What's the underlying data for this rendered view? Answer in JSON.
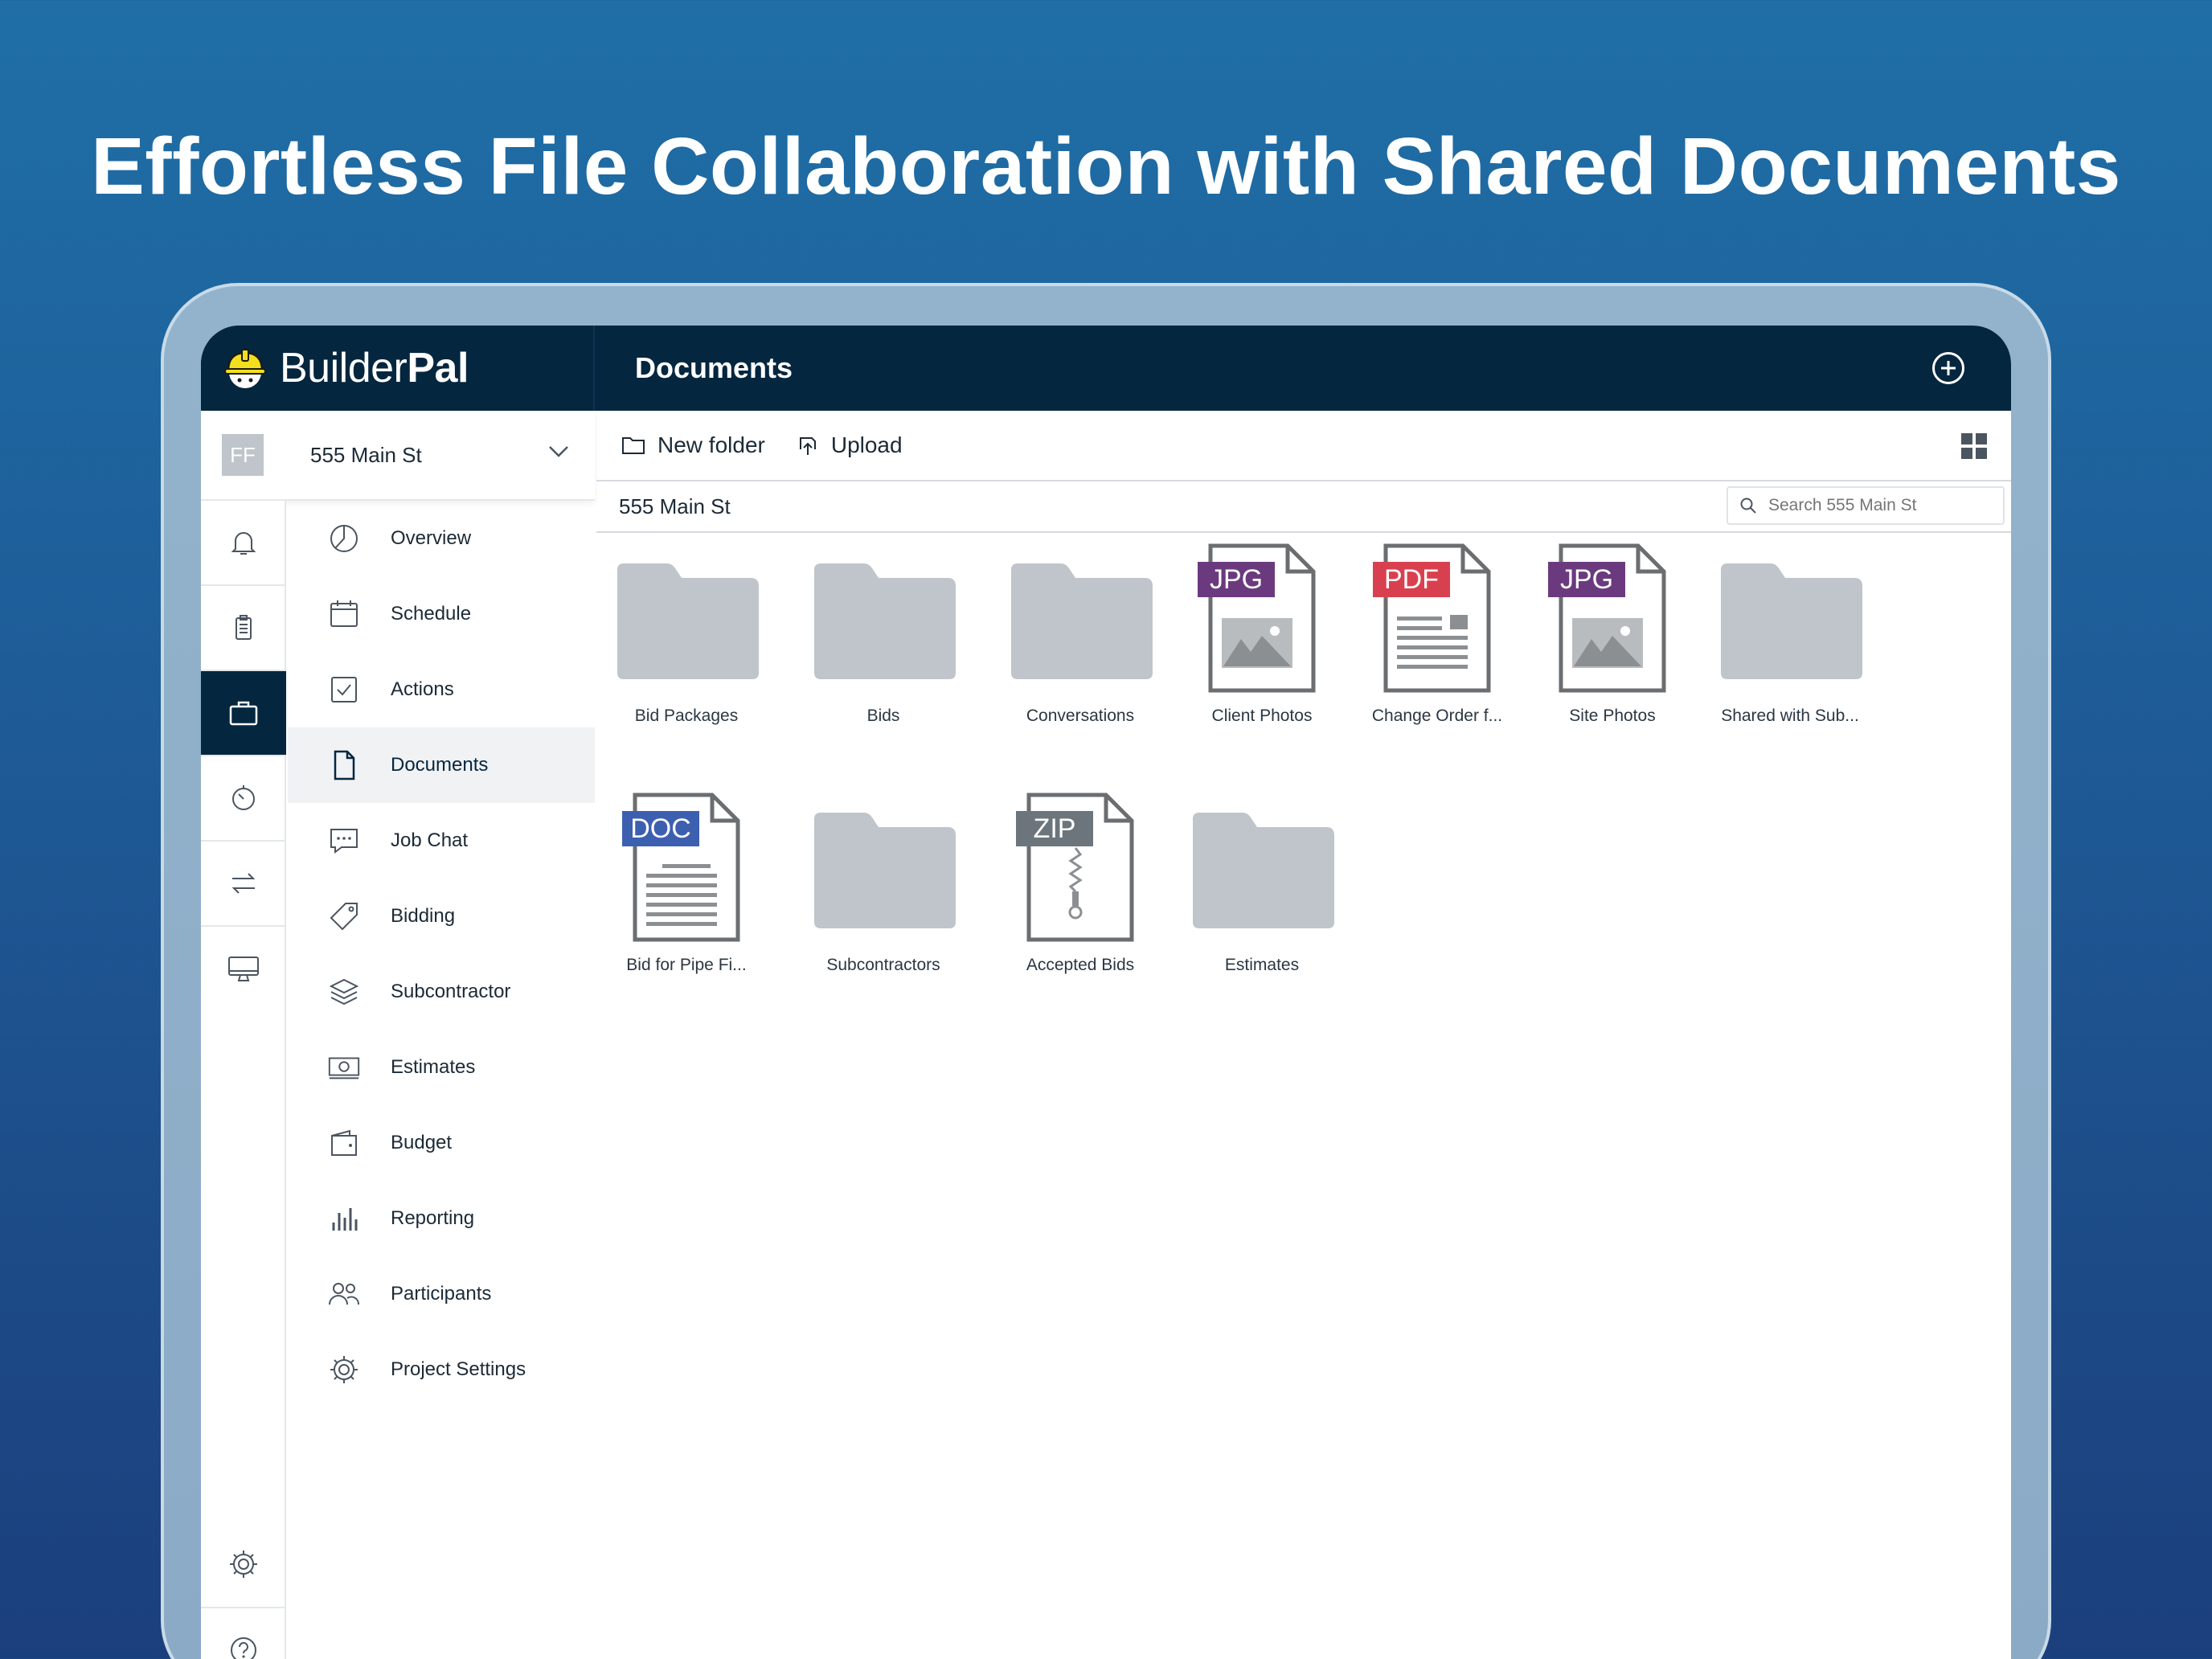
{
  "headline": "Effortless File Collaboration with Shared Documents",
  "brand": {
    "name_light": "Builder",
    "name_bold": "Pal"
  },
  "topbar": {
    "title": "Documents"
  },
  "project": {
    "initials": "FF",
    "name": "555 Main St"
  },
  "nav": {
    "items": [
      {
        "label": "Overview",
        "icon": "pie-chart-icon"
      },
      {
        "label": "Schedule",
        "icon": "calendar-icon"
      },
      {
        "label": "Actions",
        "icon": "checkbox-icon"
      },
      {
        "label": "Documents",
        "icon": "document-icon"
      },
      {
        "label": "Job Chat",
        "icon": "chat-icon"
      },
      {
        "label": "Bidding",
        "icon": "tag-icon"
      },
      {
        "label": "Subcontractor",
        "icon": "layers-icon"
      },
      {
        "label": "Estimates",
        "icon": "money-icon"
      },
      {
        "label": "Budget",
        "icon": "wallet-icon"
      },
      {
        "label": "Reporting",
        "icon": "bar-chart-icon"
      },
      {
        "label": "Participants",
        "icon": "users-icon"
      },
      {
        "label": "Project Settings",
        "icon": "gear-icon"
      }
    ],
    "active": "Documents"
  },
  "toolbar": {
    "new_folder": "New folder",
    "upload": "Upload"
  },
  "path": {
    "current": "555 Main St"
  },
  "search": {
    "placeholder": "Search 555 Main St"
  },
  "files": [
    {
      "name": "Bid Packages",
      "kind": "folder"
    },
    {
      "name": "Bids",
      "kind": "folder"
    },
    {
      "name": "Conversations",
      "kind": "folder"
    },
    {
      "name": "Client Photos",
      "kind": "file",
      "ext": "JPG",
      "color": "#6b3a7e"
    },
    {
      "name": "Change Order f...",
      "kind": "file",
      "ext": "PDF",
      "color": "#d9404f"
    },
    {
      "name": "Site Photos",
      "kind": "file",
      "ext": "JPG",
      "color": "#6b3a7e"
    },
    {
      "name": "Shared with Sub...",
      "kind": "folder"
    },
    {
      "name": "Bid for Pipe Fi...",
      "kind": "file",
      "ext": "DOC",
      "color": "#3c5fb0"
    },
    {
      "name": "Subcontractors",
      "kind": "folder"
    },
    {
      "name": "Accepted Bids",
      "kind": "file",
      "ext": "ZIP",
      "color": "#6c757c"
    },
    {
      "name": "Estimates",
      "kind": "folder"
    }
  ],
  "colors": {
    "navy": "#05263f",
    "folder": "#bfc5ca",
    "file_outline": "#6b6e71"
  }
}
